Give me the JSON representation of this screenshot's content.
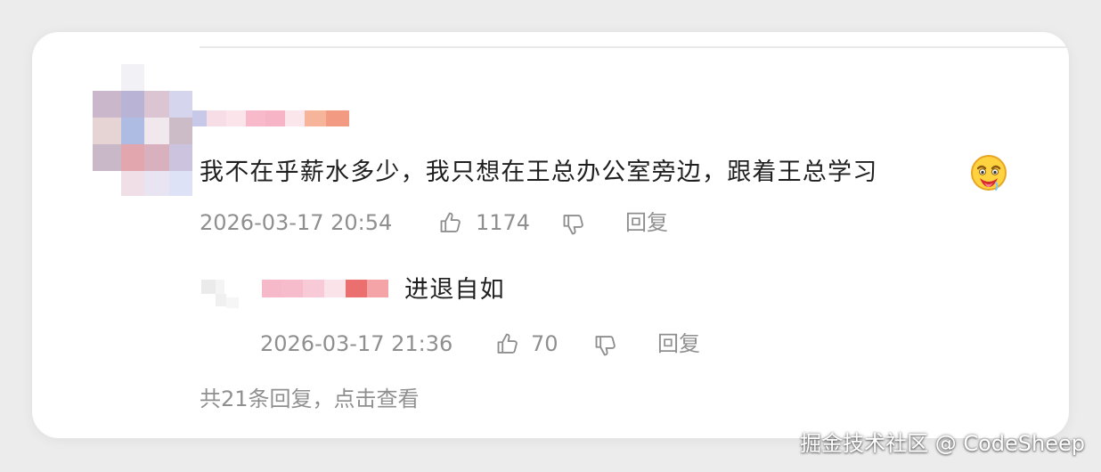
{
  "colors": {
    "page_background": "#ececec",
    "card_background": "#ffffff",
    "text_primary": "#1f1f1f",
    "text_secondary": "#8f8f8f"
  },
  "comment": {
    "author_hidden": true,
    "text": "我不在乎薪水多少，我只想在王总办公室旁边，跟着王总学习",
    "emoji": "drooling-face-emoji",
    "timestamp": "2026-03-17 20:54",
    "like_count": "1174",
    "reply_label": "回复"
  },
  "reply": {
    "author_hidden": true,
    "text": "进退自如",
    "timestamp": "2026-03-17 21:36",
    "like_count": "70",
    "reply_label": "回复"
  },
  "see_more": "共21条回复，点击查看",
  "watermark": "掘金技术社区 @ CodeSheep",
  "icons": {
    "like": "thumb-up-icon",
    "dislike": "thumb-down-icon"
  }
}
